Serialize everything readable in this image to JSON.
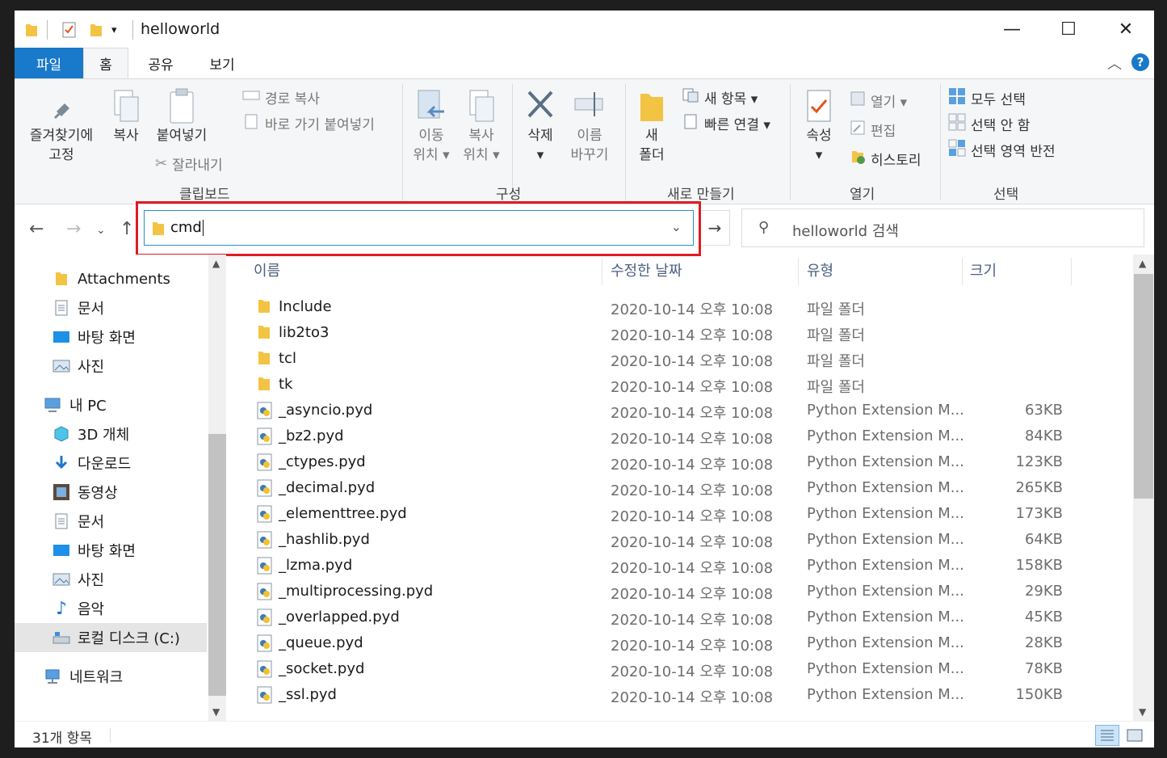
{
  "window": {
    "title": "helloworld",
    "controls": {
      "minimize": "—",
      "maximize": "☐",
      "close": "✕"
    }
  },
  "ribbon_tabs": {
    "file": "파일",
    "home": "홈",
    "share": "공유",
    "view": "보기"
  },
  "ribbon": {
    "pin": "즐겨찾기에\n고정",
    "copy": "복사",
    "paste": "붙여넣기",
    "copy_path": "경로 복사",
    "paste_shortcut": "바로 가기 붙여넣기",
    "cut": "잘라내기",
    "clipboard_group": "클립보드",
    "move_to": "이동\n위치 ▾",
    "copy_to": "복사\n위치 ▾",
    "delete": "삭제\n▾",
    "rename": "이름\n바꾸기",
    "organize_group": "구성",
    "new_folder": "새\n폴더",
    "new_item": "새 항목 ▾",
    "easy_access": "빠른 연결 ▾",
    "new_group": "새로 만들기",
    "properties": "속성\n▾",
    "open": "열기 ▾",
    "edit": "편집",
    "history": "히스토리",
    "open_group": "열기",
    "select_all": "모두 선택",
    "select_none": "선택 안 함",
    "invert_selection": "선택 영역 반전",
    "select_group": "선택"
  },
  "address": {
    "value": "cmd"
  },
  "search": {
    "placeholder": "helloworld 검색"
  },
  "nav_pane": {
    "items": [
      {
        "label": "Attachments",
        "icon": "folder-icon"
      },
      {
        "label": "문서",
        "icon": "document-icon"
      },
      {
        "label": "바탕 화면",
        "icon": "desktop-icon"
      },
      {
        "label": "사진",
        "icon": "pictures-icon"
      },
      {
        "label": "내 PC",
        "icon": "pc-icon"
      },
      {
        "label": "3D 개체",
        "icon": "cube-icon"
      },
      {
        "label": "다운로드",
        "icon": "download-icon"
      },
      {
        "label": "동영상",
        "icon": "video-icon"
      },
      {
        "label": "문서",
        "icon": "document-icon"
      },
      {
        "label": "바탕 화면",
        "icon": "desktop-icon"
      },
      {
        "label": "사진",
        "icon": "pictures-icon"
      },
      {
        "label": "음악",
        "icon": "music-icon"
      },
      {
        "label": "로컬 디스크 (C:)",
        "icon": "drive-icon"
      },
      {
        "label": "네트워크",
        "icon": "network-icon"
      }
    ]
  },
  "columns": {
    "name": "이름",
    "date": "수정한 날짜",
    "type": "유형",
    "size": "크기"
  },
  "files": [
    {
      "name": "Include",
      "date": "2020-10-14 오후 10:08",
      "type": "파일 폴더",
      "size": "",
      "kind": "folder"
    },
    {
      "name": "lib2to3",
      "date": "2020-10-14 오후 10:08",
      "type": "파일 폴더",
      "size": "",
      "kind": "folder"
    },
    {
      "name": "tcl",
      "date": "2020-10-14 오후 10:08",
      "type": "파일 폴더",
      "size": "",
      "kind": "folder"
    },
    {
      "name": "tk",
      "date": "2020-10-14 오후 10:08",
      "type": "파일 폴더",
      "size": "",
      "kind": "folder"
    },
    {
      "name": "_asyncio.pyd",
      "date": "2020-10-14 오후 10:08",
      "type": "Python Extension M...",
      "size": "63KB",
      "kind": "pyd"
    },
    {
      "name": "_bz2.pyd",
      "date": "2020-10-14 오후 10:08",
      "type": "Python Extension M...",
      "size": "84KB",
      "kind": "pyd"
    },
    {
      "name": "_ctypes.pyd",
      "date": "2020-10-14 오후 10:08",
      "type": "Python Extension M...",
      "size": "123KB",
      "kind": "pyd"
    },
    {
      "name": "_decimal.pyd",
      "date": "2020-10-14 오후 10:08",
      "type": "Python Extension M...",
      "size": "265KB",
      "kind": "pyd"
    },
    {
      "name": "_elementtree.pyd",
      "date": "2020-10-14 오후 10:08",
      "type": "Python Extension M...",
      "size": "173KB",
      "kind": "pyd"
    },
    {
      "name": "_hashlib.pyd",
      "date": "2020-10-14 오후 10:08",
      "type": "Python Extension M...",
      "size": "64KB",
      "kind": "pyd"
    },
    {
      "name": "_lzma.pyd",
      "date": "2020-10-14 오후 10:08",
      "type": "Python Extension M...",
      "size": "158KB",
      "kind": "pyd"
    },
    {
      "name": "_multiprocessing.pyd",
      "date": "2020-10-14 오후 10:08",
      "type": "Python Extension M...",
      "size": "29KB",
      "kind": "pyd"
    },
    {
      "name": "_overlapped.pyd",
      "date": "2020-10-14 오후 10:08",
      "type": "Python Extension M...",
      "size": "45KB",
      "kind": "pyd"
    },
    {
      "name": "_queue.pyd",
      "date": "2020-10-14 오후 10:08",
      "type": "Python Extension M...",
      "size": "28KB",
      "kind": "pyd"
    },
    {
      "name": "_socket.pyd",
      "date": "2020-10-14 오후 10:08",
      "type": "Python Extension M...",
      "size": "78KB",
      "kind": "pyd"
    },
    {
      "name": "_ssl.pyd",
      "date": "2020-10-14 오후 10:08",
      "type": "Python Extension M...",
      "size": "150KB",
      "kind": "pyd"
    }
  ],
  "status": {
    "count": "31개 항목"
  },
  "colors": {
    "accent": "#1979ca",
    "highlight": "#e01b24",
    "folder": "#f3c443"
  }
}
